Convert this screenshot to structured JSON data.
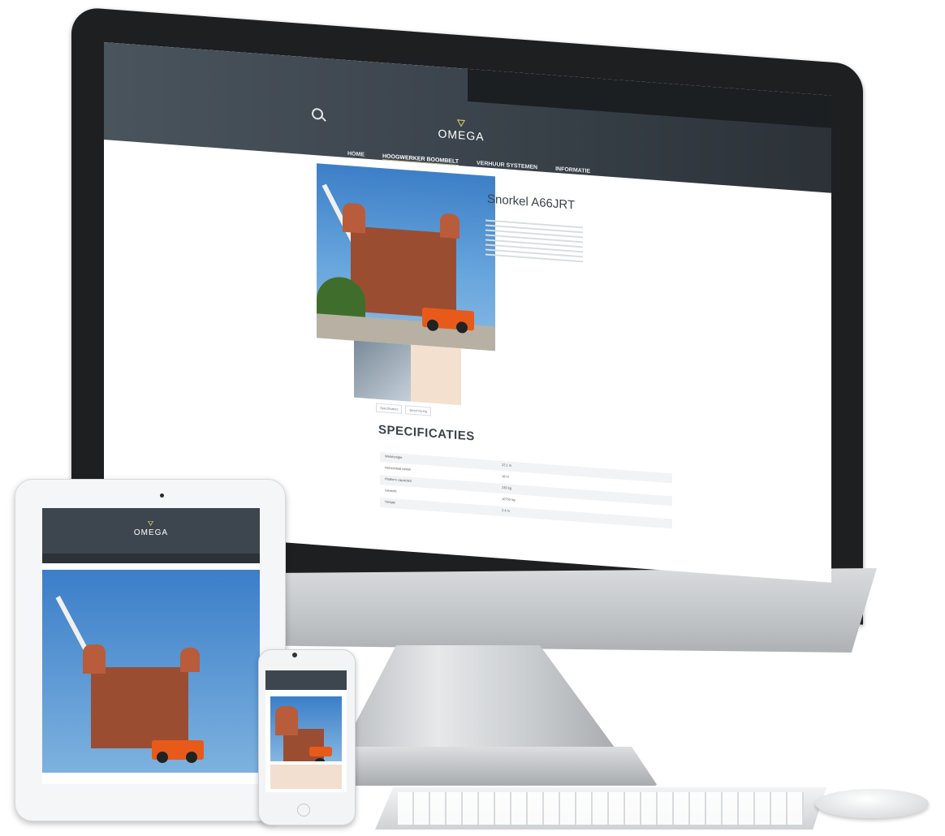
{
  "site": {
    "logo_text": "OMEGA",
    "logo_mark": "⛛",
    "nav": [
      "HOME",
      "HOOGWERKER BOOMBELT",
      "VERHUUR SYSTEMEN",
      "INFORMATIE"
    ],
    "product_title": "Snorkel A66JRT",
    "tabs": [
      "Specificaties",
      "Beschrijving"
    ],
    "spec_heading": "SPECIFICATIES",
    "spec_rows": [
      {
        "k": "Werkhoogte",
        "v": "22,1 m"
      },
      {
        "k": "Horizontaal bereik",
        "v": "18 m"
      },
      {
        "k": "Platform capaciteit",
        "v": "230 kg"
      },
      {
        "k": "Gewicht",
        "v": "10755 kg"
      },
      {
        "k": "Hoogte",
        "v": "2,4 m"
      }
    ]
  },
  "ipad": {
    "logo_text": "OMEGA"
  },
  "colors": {
    "header": "#3b444c",
    "accent": "#d4c86a",
    "lift": "#e85a1a"
  }
}
